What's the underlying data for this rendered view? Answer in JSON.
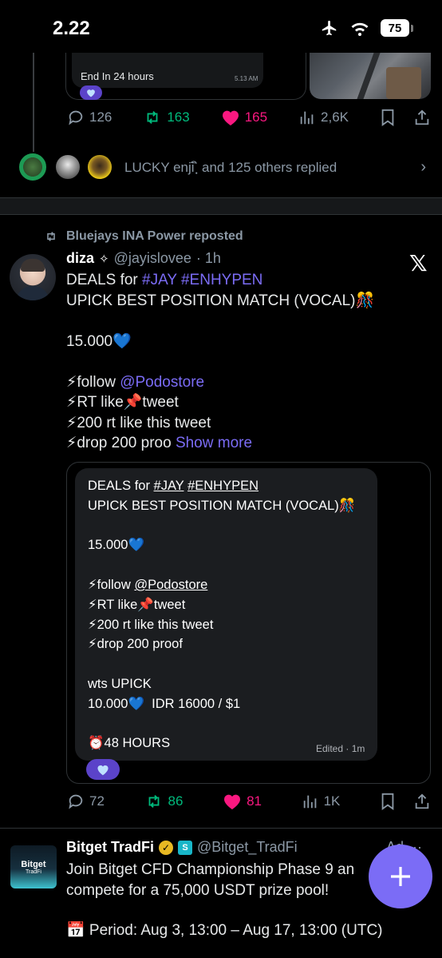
{
  "status_bar": {
    "time": "2.22",
    "battery": "75"
  },
  "prev_post": {
    "card_text": "End In 24 hours",
    "card_time": "5.13 AM",
    "stats": {
      "replies": "126",
      "reposts": "163",
      "likes": "165",
      "views": "2,6K"
    }
  },
  "replied_summary": "LUCKY enji ิฺ and 125 others replied",
  "repost_label": "Bluejays INA Power reposted",
  "post": {
    "name": "diza",
    "handle": "@jayislovee",
    "time": "· 1h",
    "lines": {
      "l1_prefix": "DEALS for ",
      "l1_tags": "#JAY #ENHYPEN",
      "l2": "UPICK BEST POSITION MATCH (VOCAL)🎊",
      "l3": "15.000💙",
      "l4_prefix": "⚡follow ",
      "l4_link": "@Podostore",
      "l5": "⚡RT like📌tweet",
      "l6": "⚡200 rt like this tweet",
      "l7": "⚡drop 200 proo",
      "show_more": "Show more"
    },
    "quoted": {
      "l1_prefix": "DEALS for ",
      "l1_tag1": "#JAY",
      "l1_tag2": "#ENHYPEN",
      "l2": "UPICK BEST POSITION MATCH (VOCAL)🎊",
      "l3": "15.000💙",
      "l4_prefix": "⚡follow ",
      "l4_link": "@Podostore",
      "l5": "⚡RT like📌tweet",
      "l6": "⚡200 rt like this tweet",
      "l7": "⚡drop 200 proof",
      "l8": "wts UPICK",
      "l9": "10.000💙  IDR 16000 / $1",
      "l10": "⏰48 HOURS",
      "edited": "Edited · 1m"
    },
    "stats": {
      "replies": "72",
      "reposts": "86",
      "likes": "81",
      "views": "1K"
    }
  },
  "ad": {
    "name": "Bitget TradFi",
    "handle": "@Bitget_TradFi",
    "avatar_text": "Bitget",
    "avatar_sub": "TradFi",
    "body1": "Join Bitget CFD Championship Phase 9 an",
    "body2": "compete for a 75,000 USDT prize pool!",
    "period": "📅 Period: Aug 3, 13:00 – Aug 17, 13:00 (UTC)",
    "ad_label": "Ad"
  },
  "colors": {
    "accent": "#7b6cf6",
    "repost_green": "#00ba7c",
    "like_pink": "#f91880",
    "muted": "#8b98a5"
  }
}
